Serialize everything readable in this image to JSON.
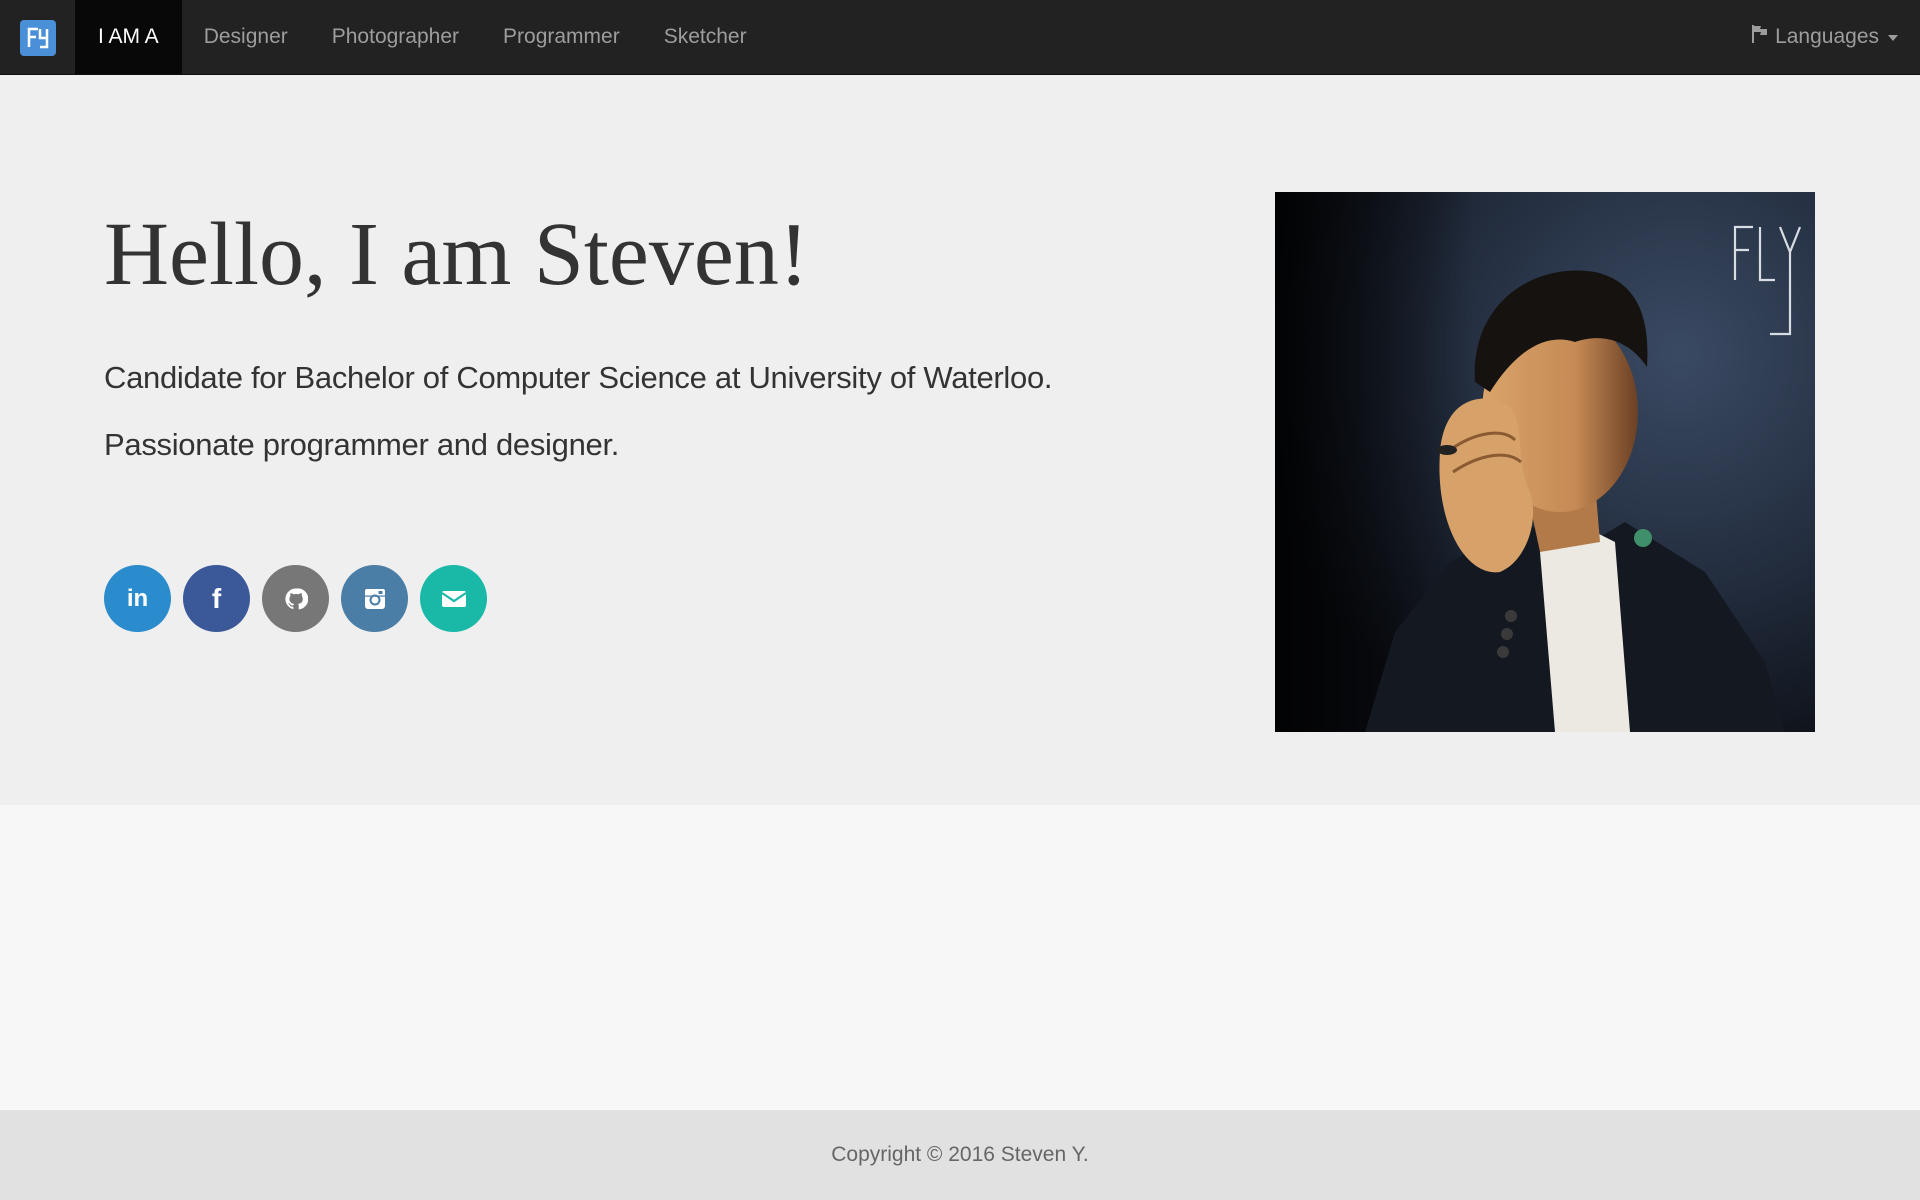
{
  "nav": {
    "brand_icon": "fy-logo-icon",
    "items": [
      {
        "label": "I AM A",
        "active": true
      },
      {
        "label": "Designer",
        "active": false
      },
      {
        "label": "Photographer",
        "active": false
      },
      {
        "label": "Programmer",
        "active": false
      },
      {
        "label": "Sketcher",
        "active": false
      }
    ],
    "languages_label": "Languages",
    "languages_icon": "flag-icon"
  },
  "hero": {
    "title": "Hello, I am Steven!",
    "line1": "Candidate for Bachelor of Computer Science at University of Waterloo.",
    "line2": "Passionate programmer and designer.",
    "socials": [
      {
        "name": "linkedin",
        "icon": "linkedin-icon",
        "glyph": "in",
        "color": "#2a8ccc"
      },
      {
        "name": "facebook",
        "icon": "facebook-icon",
        "glyph": "f",
        "color": "#3b5998"
      },
      {
        "name": "github",
        "icon": "github-icon",
        "glyph": "",
        "color": "#777777"
      },
      {
        "name": "instagram",
        "icon": "instagram-icon",
        "glyph": "",
        "color": "#4a7ea6"
      },
      {
        "name": "email",
        "icon": "envelope-icon",
        "glyph": "",
        "color": "#1ab9a7"
      }
    ],
    "photo_watermark": "FY"
  },
  "footer": {
    "copyright": "Copyright © 2016 Steven Y."
  }
}
